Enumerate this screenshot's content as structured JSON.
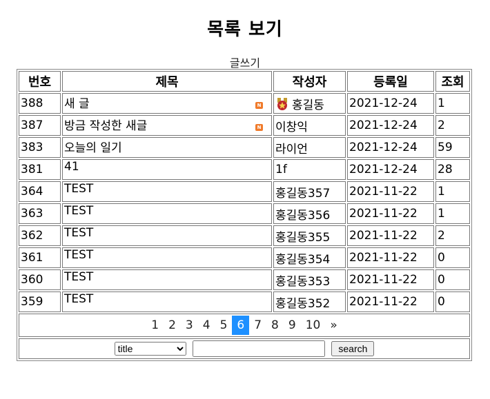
{
  "page_title": "목록 보기",
  "write_label": "글쓰기",
  "headers": {
    "num": "번호",
    "title": "제목",
    "writer": "작성자",
    "date": "등록일",
    "views": "조회"
  },
  "rows": [
    {
      "num": "388",
      "title": "새 글",
      "writer": "홍길동",
      "date": "2021-12-24",
      "views": "1",
      "is_new": true,
      "writer_icon": true
    },
    {
      "num": "387",
      "title": "방금 작성한 새글",
      "writer": "이창익",
      "date": "2021-12-24",
      "views": "2",
      "is_new": true,
      "writer_icon": false
    },
    {
      "num": "383",
      "title": "오늘의 일기",
      "writer": "라이언",
      "date": "2021-12-24",
      "views": "59",
      "is_new": false,
      "writer_icon": false
    },
    {
      "num": "381",
      "title": "41",
      "writer": "1f",
      "date": "2021-12-24",
      "views": "28",
      "is_new": false,
      "writer_icon": false
    },
    {
      "num": "364",
      "title": "TEST",
      "writer": "홍길동357",
      "date": "2021-11-22",
      "views": "1",
      "is_new": false,
      "writer_icon": false
    },
    {
      "num": "363",
      "title": "TEST",
      "writer": "홍길동356",
      "date": "2021-11-22",
      "views": "1",
      "is_new": false,
      "writer_icon": false
    },
    {
      "num": "362",
      "title": "TEST",
      "writer": "홍길동355",
      "date": "2021-11-22",
      "views": "2",
      "is_new": false,
      "writer_icon": false
    },
    {
      "num": "361",
      "title": "TEST",
      "writer": "홍길동354",
      "date": "2021-11-22",
      "views": "0",
      "is_new": false,
      "writer_icon": false
    },
    {
      "num": "360",
      "title": "TEST",
      "writer": "홍길동353",
      "date": "2021-11-22",
      "views": "0",
      "is_new": false,
      "writer_icon": false
    },
    {
      "num": "359",
      "title": "TEST",
      "writer": "홍길동352",
      "date": "2021-11-22",
      "views": "0",
      "is_new": false,
      "writer_icon": false
    }
  ],
  "pagination": {
    "pages": [
      "1",
      "2",
      "3",
      "4",
      "5",
      "6",
      "7",
      "8",
      "9",
      "10"
    ],
    "current": "6",
    "next": "»"
  },
  "search": {
    "field_selected": "title",
    "query": "",
    "button_label": "search"
  },
  "colors": {
    "active_page": "#1e90ff",
    "new_badge": "#f07a2a"
  },
  "icons": {
    "new_badge": "new-badge-icon",
    "writer_icon": "medal-icon"
  }
}
